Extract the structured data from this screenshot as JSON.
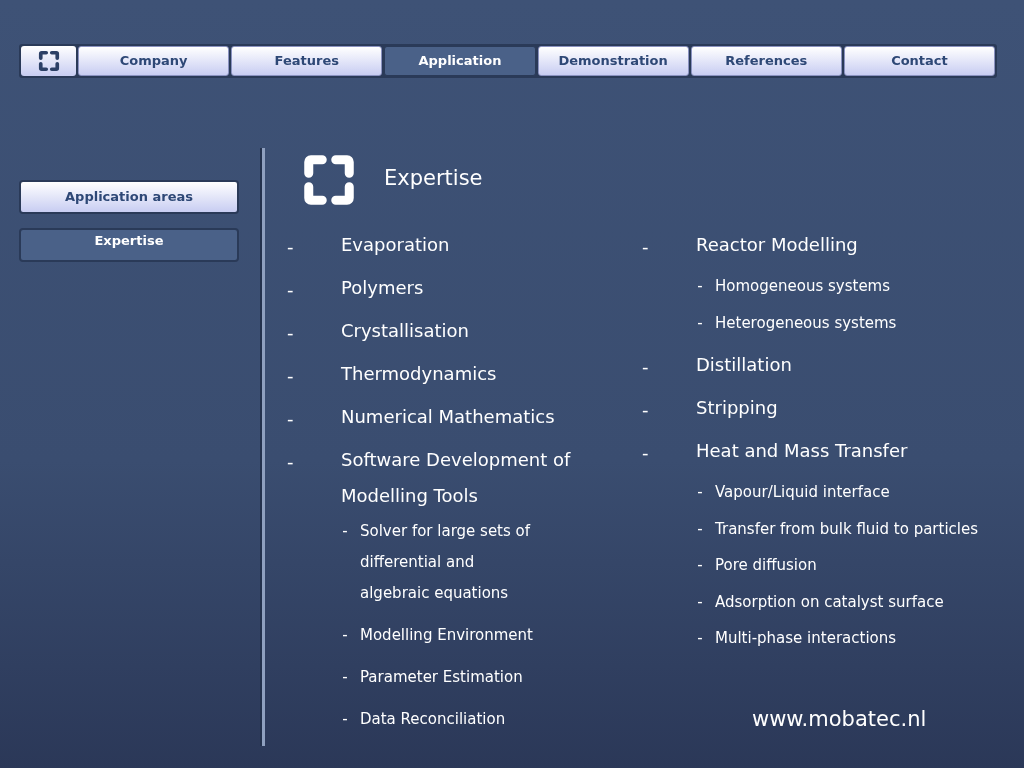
{
  "nav": {
    "items": [
      {
        "label": "Company",
        "selected": false
      },
      {
        "label": "Features",
        "selected": false
      },
      {
        "label": "Application",
        "selected": true
      },
      {
        "label": "Demonstration",
        "selected": false
      },
      {
        "label": "References",
        "selected": false
      },
      {
        "label": "Contact",
        "selected": false
      }
    ]
  },
  "sidebar": {
    "items": [
      {
        "label": "Application areas",
        "selected": false
      },
      {
        "label": "Expertise",
        "selected": true
      }
    ]
  },
  "content": {
    "title": "Expertise",
    "columns": [
      [
        {
          "bullet": "-",
          "text": "Evaporation"
        },
        {
          "bullet": "-",
          "text": "Polymers"
        },
        {
          "bullet": "-",
          "text": "Crystallisation"
        },
        {
          "bullet": "-",
          "text": "Thermodynamics"
        },
        {
          "bullet": "-",
          "text": "Numerical Mathematics"
        },
        {
          "bullet": "-",
          "text": "Software Development of Modelling Tools",
          "children": [
            {
              "bullet": "-",
              "text": "Solver for large sets of differential and algebraic equations"
            },
            {
              "bullet": "-",
              "text": "Modelling Environment"
            },
            {
              "bullet": "-",
              "text": "Parameter Estimation"
            },
            {
              "bullet": "-",
              "text": "Data Reconciliation"
            }
          ]
        }
      ],
      [
        {
          "bullet": "-",
          "text": "Reactor Modelling",
          "children": [
            {
              "bullet": "-",
              "text": "Homogeneous systems"
            },
            {
              "bullet": "-",
              "text": "Heterogeneous systems"
            }
          ]
        },
        {
          "bullet": "-",
          "text": "Distillation"
        },
        {
          "bullet": "-",
          "text": "Stripping"
        },
        {
          "bullet": "-",
          "text": "Heat and Mass Transfer",
          "children": [
            {
              "bullet": "-",
              "text": "Vapour/Liquid interface"
            },
            {
              "bullet": "-",
              "text": "Transfer from bulk fluid to particles"
            },
            {
              "bullet": "-",
              "text": "Pore diffusion"
            },
            {
              "bullet": "-",
              "text": "Adsorption on catalyst surface"
            },
            {
              "bullet": "-",
              "text": "Multi-phase interactions"
            }
          ]
        }
      ]
    ]
  },
  "footer": {
    "url": "www.mobatec.nl"
  }
}
